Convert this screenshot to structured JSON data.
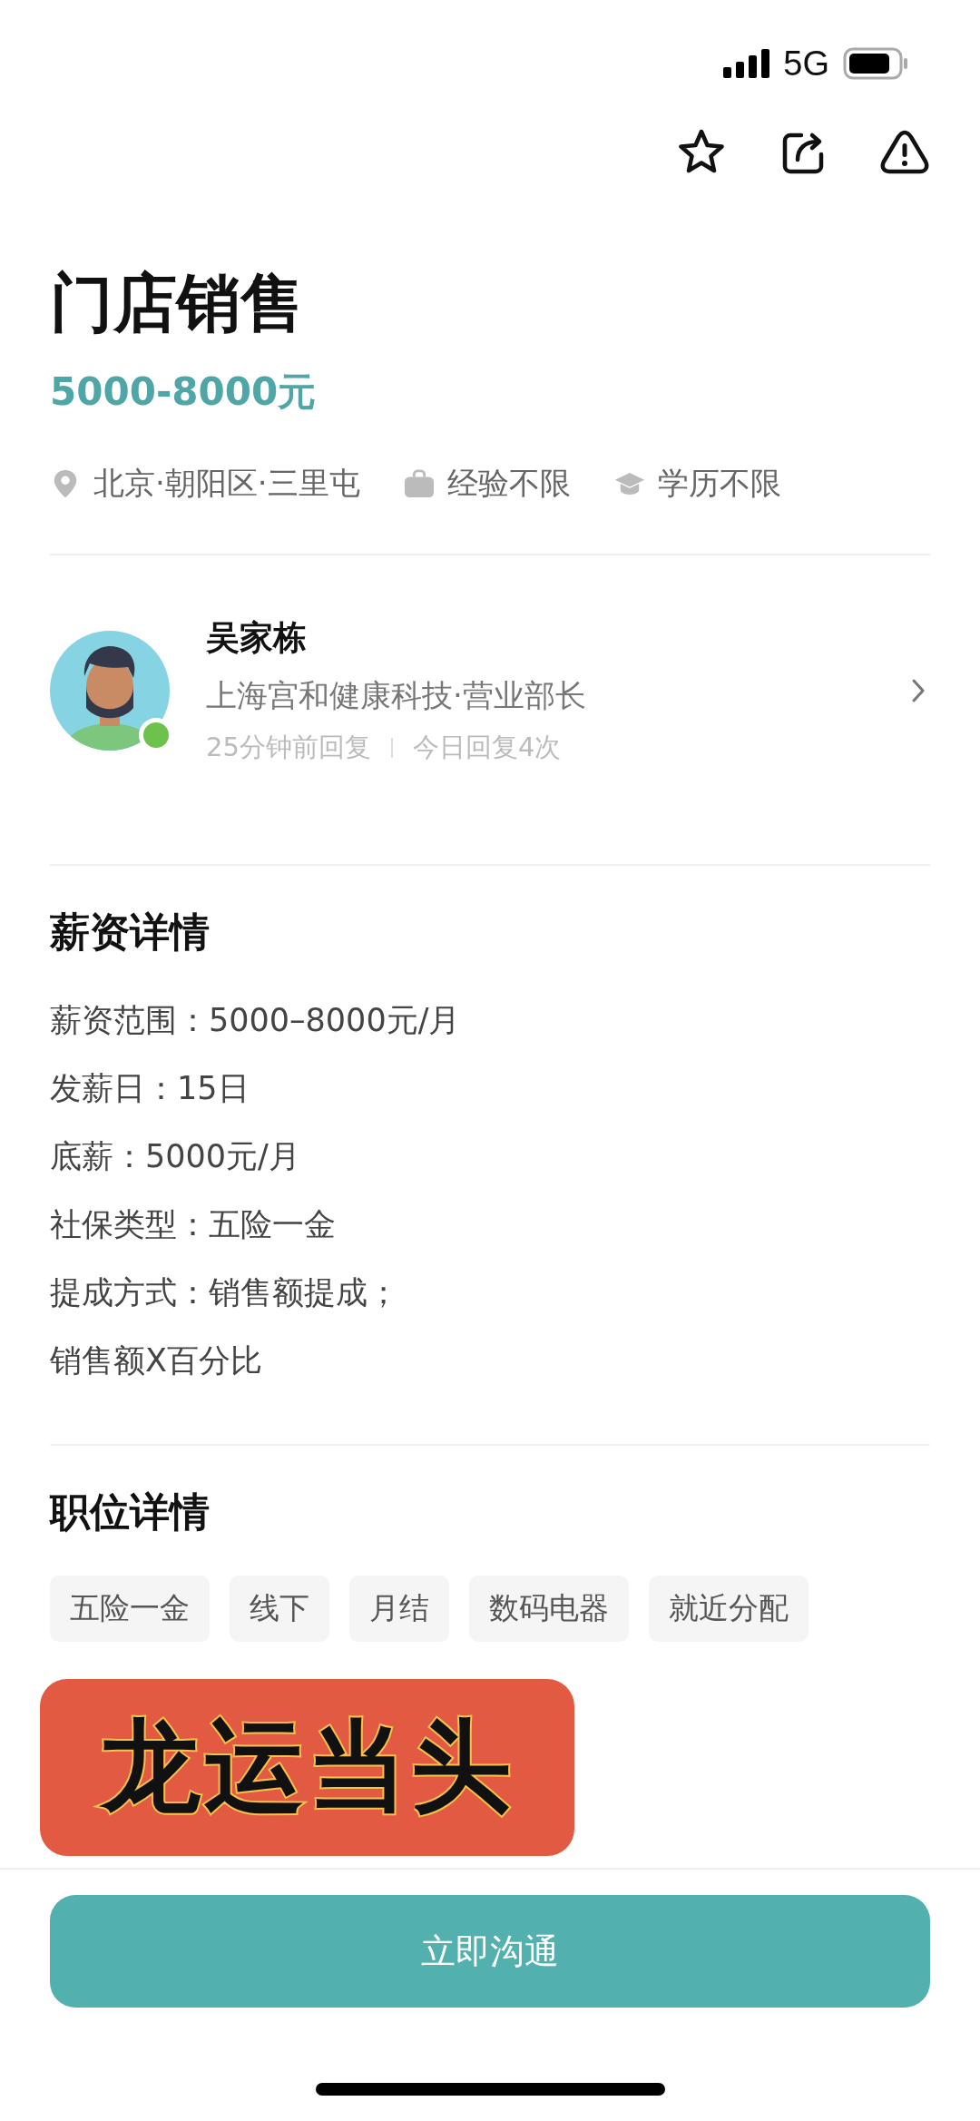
{
  "status_bar": {
    "network": "5G"
  },
  "job": {
    "title": "门店销售",
    "salary": "5000-8000元",
    "requirements": [
      {
        "kind": "location",
        "text": "北京·朝阳区·三里屯"
      },
      {
        "kind": "experience",
        "text": "经验不限"
      },
      {
        "kind": "education",
        "text": "学历不限"
      }
    ]
  },
  "recruiter": {
    "name": "吴家栋",
    "company": "上海宫和健康科技·营业部长",
    "online": true,
    "reply_time": "25分钟前回复",
    "reply_count": "今日回复4次"
  },
  "salary_details": {
    "heading": "薪资详情",
    "lines": [
      "薪资范围：5000–8000元/月",
      "发薪日：15日",
      "底薪：5000元/月",
      "社保类型：五险一金",
      "提成方式：销售额提成；",
      "销售额X百分比"
    ]
  },
  "job_details": {
    "heading": "职位详情",
    "tags": [
      "五险一金",
      "线下",
      "月结",
      "数码电器",
      "就近分配"
    ]
  },
  "sticker": {
    "text": "龙运当头"
  },
  "contact_button": {
    "label": "立即沟通"
  }
}
